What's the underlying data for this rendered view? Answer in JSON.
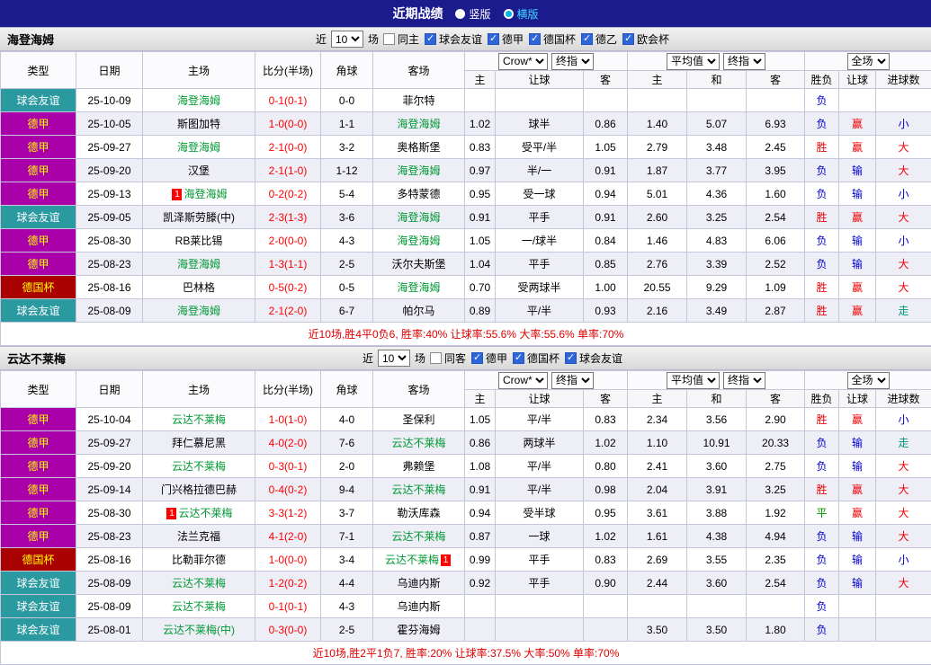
{
  "topbar": {
    "title": "近期战绩",
    "vertical_label": "竖版",
    "horizontal_label": "横版"
  },
  "columns": {
    "type": "类型",
    "date": "日期",
    "home": "主场",
    "score": "比分(半场)",
    "corner": "角球",
    "away": "客场",
    "odds_home": "主",
    "odds_handicap": "让球",
    "odds_away": "客",
    "avg_home": "主",
    "avg_draw": "和",
    "avg_away": "客",
    "result": "胜负",
    "handicap_result": "让球",
    "goals": "进球数"
  },
  "league_colors": {
    "球会友谊": {
      "bg": "#2B9AA0",
      "fg": "#FFFFFF"
    },
    "德甲": {
      "bg": "#AA00AA",
      "fg": "#FFFF00"
    },
    "德国杯": {
      "bg": "#AA0000",
      "fg": "#FFFF00"
    }
  },
  "value_colors": {
    "胜": "#EE0000",
    "负": "#0000CC",
    "平": "#009900",
    "赢": "#EE0000",
    "输": "#0000CC",
    "大": "#EE0000",
    "小": "#0000CC",
    "走": "#009977"
  },
  "text_colors": {
    "focus_team": "#009933",
    "normal_team": "#000000",
    "score": "#FF0000"
  },
  "sections": [
    {
      "team": "海登海姆",
      "filters": {
        "recent_label": "近",
        "recent_value": "10",
        "games_label": "场",
        "checkboxes": [
          {
            "label": "同主",
            "checked": false
          },
          {
            "label": "球会友谊",
            "checked": true
          },
          {
            "label": "德甲",
            "checked": true
          },
          {
            "label": "德国杯",
            "checked": true
          },
          {
            "label": "德乙",
            "checked": true
          },
          {
            "label": "欧会杯",
            "checked": true
          }
        ]
      },
      "selects": {
        "odds_source": "Crow*",
        "odds_time": "终指",
        "avg_source": "平均值",
        "avg_time": "终指",
        "scope": "全场"
      },
      "rows": [
        {
          "league": "球会友谊",
          "date": "25-10-09",
          "home": {
            "name": "海登海姆",
            "focus": true
          },
          "score": "0-1(0-1)",
          "corner": "0-0",
          "away": {
            "name": "菲尔特",
            "focus": false
          },
          "odds": [
            "",
            "",
            ""
          ],
          "avg": [
            "",
            "",
            ""
          ],
          "result": "负",
          "handicap_result": "",
          "goals": ""
        },
        {
          "league": "德甲",
          "date": "25-10-05",
          "home": {
            "name": "斯图加特",
            "focus": false
          },
          "score": "1-0(0-0)",
          "corner": "1-1",
          "away": {
            "name": "海登海姆",
            "focus": true
          },
          "odds": [
            "1.02",
            "球半",
            "0.86"
          ],
          "avg": [
            "1.40",
            "5.07",
            "6.93"
          ],
          "result": "负",
          "handicap_result": "赢",
          "goals": "小"
        },
        {
          "league": "德甲",
          "date": "25-09-27",
          "home": {
            "name": "海登海姆",
            "focus": true
          },
          "score": "2-1(0-0)",
          "corner": "3-2",
          "away": {
            "name": "奥格斯堡",
            "focus": false
          },
          "odds": [
            "0.83",
            "受平/半",
            "1.05"
          ],
          "avg": [
            "2.79",
            "3.48",
            "2.45"
          ],
          "result": "胜",
          "handicap_result": "赢",
          "goals": "大"
        },
        {
          "league": "德甲",
          "date": "25-09-20",
          "home": {
            "name": "汉堡",
            "focus": false
          },
          "score": "2-1(1-0)",
          "corner": "1-12",
          "away": {
            "name": "海登海姆",
            "focus": true
          },
          "odds": [
            "0.97",
            "半/一",
            "0.91"
          ],
          "avg": [
            "1.87",
            "3.77",
            "3.95"
          ],
          "result": "负",
          "handicap_result": "输",
          "goals": "大"
        },
        {
          "league": "德甲",
          "date": "25-09-13",
          "home": {
            "name": "海登海姆",
            "focus": true,
            "card": "before"
          },
          "score": "0-2(0-2)",
          "corner": "5-4",
          "away": {
            "name": "多特蒙德",
            "focus": false
          },
          "odds": [
            "0.95",
            "受一球",
            "0.94"
          ],
          "avg": [
            "5.01",
            "4.36",
            "1.60"
          ],
          "result": "负",
          "handicap_result": "输",
          "goals": "小"
        },
        {
          "league": "球会友谊",
          "date": "25-09-05",
          "home": {
            "name": "凯泽斯劳滕(中)",
            "focus": false
          },
          "score": "2-3(1-3)",
          "corner": "3-6",
          "away": {
            "name": "海登海姆",
            "focus": true
          },
          "odds": [
            "0.91",
            "平手",
            "0.91"
          ],
          "avg": [
            "2.60",
            "3.25",
            "2.54"
          ],
          "result": "胜",
          "handicap_result": "赢",
          "goals": "大"
        },
        {
          "league": "德甲",
          "date": "25-08-30",
          "home": {
            "name": "RB莱比锡",
            "focus": false
          },
          "score": "2-0(0-0)",
          "corner": "4-3",
          "away": {
            "name": "海登海姆",
            "focus": true
          },
          "odds": [
            "1.05",
            "一/球半",
            "0.84"
          ],
          "avg": [
            "1.46",
            "4.83",
            "6.06"
          ],
          "result": "负",
          "handicap_result": "输",
          "goals": "小"
        },
        {
          "league": "德甲",
          "date": "25-08-23",
          "home": {
            "name": "海登海姆",
            "focus": true
          },
          "score": "1-3(1-1)",
          "corner": "2-5",
          "away": {
            "name": "沃尔夫斯堡",
            "focus": false
          },
          "odds": [
            "1.04",
            "平手",
            "0.85"
          ],
          "avg": [
            "2.76",
            "3.39",
            "2.52"
          ],
          "result": "负",
          "handicap_result": "输",
          "goals": "大"
        },
        {
          "league": "德国杯",
          "date": "25-08-16",
          "home": {
            "name": "巴林格",
            "focus": false
          },
          "score": "0-5(0-2)",
          "corner": "0-5",
          "away": {
            "name": "海登海姆",
            "focus": true
          },
          "odds": [
            "0.70",
            "受两球半",
            "1.00"
          ],
          "avg": [
            "20.55",
            "9.29",
            "1.09"
          ],
          "result": "胜",
          "handicap_result": "赢",
          "goals": "大"
        },
        {
          "league": "球会友谊",
          "date": "25-08-09",
          "home": {
            "name": "海登海姆",
            "focus": true
          },
          "score": "2-1(2-0)",
          "corner": "6-7",
          "away": {
            "name": "帕尔马",
            "focus": false
          },
          "odds": [
            "0.89",
            "平/半",
            "0.93"
          ],
          "avg": [
            "2.16",
            "3.49",
            "2.87"
          ],
          "result": "胜",
          "handicap_result": "赢",
          "goals": "走"
        }
      ],
      "summary": "近10场,胜4平0负6, 胜率:40% 让球率:55.6% 大率:55.6% 单率:70%"
    },
    {
      "team": "云达不莱梅",
      "filters": {
        "recent_label": "近",
        "recent_value": "10",
        "games_label": "场",
        "checkboxes": [
          {
            "label": "同客",
            "checked": false
          },
          {
            "label": "德甲",
            "checked": true
          },
          {
            "label": "德国杯",
            "checked": true
          },
          {
            "label": "球会友谊",
            "checked": true
          }
        ]
      },
      "selects": {
        "odds_source": "Crow*",
        "odds_time": "终指",
        "avg_source": "平均值",
        "avg_time": "终指",
        "scope": "全场"
      },
      "rows": [
        {
          "league": "德甲",
          "date": "25-10-04",
          "home": {
            "name": "云达不莱梅",
            "focus": true
          },
          "score": "1-0(1-0)",
          "corner": "4-0",
          "away": {
            "name": "圣保利",
            "focus": false
          },
          "odds": [
            "1.05",
            "平/半",
            "0.83"
          ],
          "avg": [
            "2.34",
            "3.56",
            "2.90"
          ],
          "result": "胜",
          "handicap_result": "赢",
          "goals": "小"
        },
        {
          "league": "德甲",
          "date": "25-09-27",
          "home": {
            "name": "拜仁慕尼黑",
            "focus": false
          },
          "score": "4-0(2-0)",
          "corner": "7-6",
          "away": {
            "name": "云达不莱梅",
            "focus": true
          },
          "odds": [
            "0.86",
            "两球半",
            "1.02"
          ],
          "avg": [
            "1.10",
            "10.91",
            "20.33"
          ],
          "result": "负",
          "handicap_result": "输",
          "goals": "走"
        },
        {
          "league": "德甲",
          "date": "25-09-20",
          "home": {
            "name": "云达不莱梅",
            "focus": true
          },
          "score": "0-3(0-1)",
          "corner": "2-0",
          "away": {
            "name": "弗赖堡",
            "focus": false
          },
          "odds": [
            "1.08",
            "平/半",
            "0.80"
          ],
          "avg": [
            "2.41",
            "3.60",
            "2.75"
          ],
          "result": "负",
          "handicap_result": "输",
          "goals": "大"
        },
        {
          "league": "德甲",
          "date": "25-09-14",
          "home": {
            "name": "门兴格拉德巴赫",
            "focus": false
          },
          "score": "0-4(0-2)",
          "corner": "9-4",
          "away": {
            "name": "云达不莱梅",
            "focus": true
          },
          "odds": [
            "0.91",
            "平/半",
            "0.98"
          ],
          "avg": [
            "2.04",
            "3.91",
            "3.25"
          ],
          "result": "胜",
          "handicap_result": "赢",
          "goals": "大"
        },
        {
          "league": "德甲",
          "date": "25-08-30",
          "home": {
            "name": "云达不莱梅",
            "focus": true,
            "card": "before"
          },
          "score": "3-3(1-2)",
          "corner": "3-7",
          "away": {
            "name": "勒沃库森",
            "focus": false
          },
          "odds": [
            "0.94",
            "受半球",
            "0.95"
          ],
          "avg": [
            "3.61",
            "3.88",
            "1.92"
          ],
          "result": "平",
          "handicap_result": "赢",
          "goals": "大"
        },
        {
          "league": "德甲",
          "date": "25-08-23",
          "home": {
            "name": "法兰克福",
            "focus": false
          },
          "score": "4-1(2-0)",
          "corner": "7-1",
          "away": {
            "name": "云达不莱梅",
            "focus": true
          },
          "odds": [
            "0.87",
            "一球",
            "1.02"
          ],
          "avg": [
            "1.61",
            "4.38",
            "4.94"
          ],
          "result": "负",
          "handicap_result": "输",
          "goals": "大"
        },
        {
          "league": "德国杯",
          "date": "25-08-16",
          "home": {
            "name": "比勒菲尔德",
            "focus": false
          },
          "score": "1-0(0-0)",
          "corner": "3-4",
          "away": {
            "name": "云达不莱梅",
            "focus": true,
            "card": "after"
          },
          "odds": [
            "0.99",
            "平手",
            "0.83"
          ],
          "avg": [
            "2.69",
            "3.55",
            "2.35"
          ],
          "result": "负",
          "handicap_result": "输",
          "goals": "小"
        },
        {
          "league": "球会友谊",
          "date": "25-08-09",
          "home": {
            "name": "云达不莱梅",
            "focus": true
          },
          "score": "1-2(0-2)",
          "corner": "4-4",
          "away": {
            "name": "乌迪内斯",
            "focus": false
          },
          "odds": [
            "0.92",
            "平手",
            "0.90"
          ],
          "avg": [
            "2.44",
            "3.60",
            "2.54"
          ],
          "result": "负",
          "handicap_result": "输",
          "goals": "大"
        },
        {
          "league": "球会友谊",
          "date": "25-08-09",
          "home": {
            "name": "云达不莱梅",
            "focus": true
          },
          "score": "0-1(0-1)",
          "corner": "4-3",
          "away": {
            "name": "乌迪内斯",
            "focus": false
          },
          "odds": [
            "",
            "",
            ""
          ],
          "avg": [
            "",
            "",
            ""
          ],
          "result": "负",
          "handicap_result": "",
          "goals": ""
        },
        {
          "league": "球会友谊",
          "date": "25-08-01",
          "home": {
            "name": "云达不莱梅(中)",
            "focus": true
          },
          "score": "0-3(0-0)",
          "corner": "2-5",
          "away": {
            "name": "霍芬海姆",
            "focus": false
          },
          "odds": [
            "",
            "",
            ""
          ],
          "avg": [
            "3.50",
            "3.50",
            "1.80"
          ],
          "result": "负",
          "handicap_result": "",
          "goals": ""
        }
      ],
      "summary": "近10场,胜2平1负7, 胜率:20% 让球率:37.5% 大率:50% 单率:70%"
    }
  ]
}
